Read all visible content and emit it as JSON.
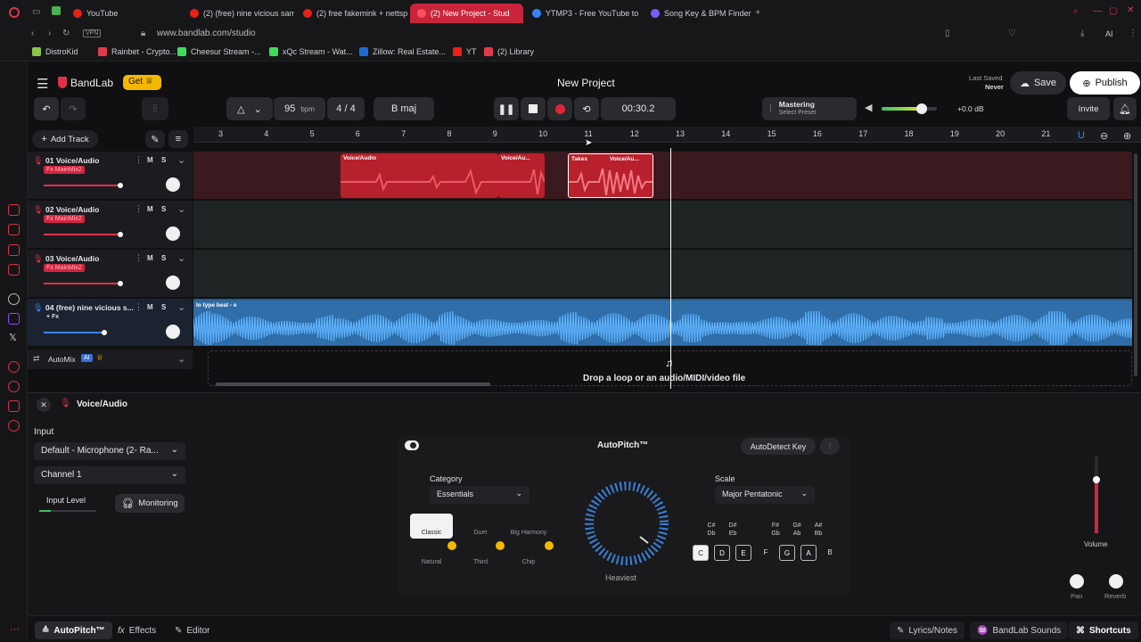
{
  "browser": {
    "tabs": [
      {
        "label": "YouTube",
        "color": "#e62117"
      },
      {
        "label": "(2) (free) nine vicious sam",
        "color": "#e62117"
      },
      {
        "label": "(2) free fakemink + nettsp",
        "color": "#e62117"
      },
      {
        "label": "(2) New Project - Stud",
        "color": "#ff4d5e",
        "active": true
      },
      {
        "label": "YTMP3 - Free YouTube to",
        "color": "#3b82f6"
      },
      {
        "label": "Song Key & BPM Finder | T",
        "color": "#7c5cff"
      }
    ],
    "url": "www.bandlab.com/studio",
    "bookmarks": [
      {
        "label": "DistroKid",
        "color": "#8bc34a"
      },
      {
        "label": "Rainbet - Crypto...",
        "color": "#e23a4b"
      },
      {
        "label": "Cheesur Stream -...",
        "color": "#3ddc5a"
      },
      {
        "label": "xQc Stream - Wat...",
        "color": "#3ddc5a"
      },
      {
        "label": "Zillow: Real Estate...",
        "color": "#1e6bd6"
      },
      {
        "label": "YT",
        "color": "#e62117"
      },
      {
        "label": "(2) Library",
        "color": "#e23a4b"
      }
    ],
    "ai_label": "AI"
  },
  "header": {
    "brand": "BandLab",
    "get_label": "Get",
    "project_title": "New Project",
    "last_saved_label": "Last Saved",
    "last_saved_value": "Never",
    "save_label": "Save",
    "publish_label": "Publish"
  },
  "transport": {
    "bpm": "95",
    "bpm_unit": "bpm",
    "time_signature": "4 / 4",
    "key": "B maj",
    "time": "00:30.2",
    "mastering_title": "Mastering",
    "mastering_sub": "Select Preset",
    "db": "+0.0 dB",
    "invite_label": "Invite",
    "volume_level": 0.7
  },
  "toolbar": {
    "add_track_label": "Add Track"
  },
  "ruler": [
    "3",
    "4",
    "5",
    "6",
    "7",
    "8",
    "9",
    "10",
    "11",
    "12",
    "13",
    "14",
    "15",
    "16",
    "17",
    "18",
    "19",
    "20",
    "21"
  ],
  "tracks": [
    {
      "name": "01  Voice/Audio",
      "fx": "Fx  MainMix2"
    },
    {
      "name": "02  Voice/Audio",
      "fx": "Fx  MainMix2"
    },
    {
      "name": "03  Voice/Audio",
      "fx": "Fx  MainMix2"
    },
    {
      "name": "04  (free) nine vicious s...",
      "fx": "+ Fx"
    }
  ],
  "regions": {
    "r1": "Voice/Audio",
    "r2": "Voice/Au...",
    "r3_takes": "Takes",
    "r3": "Voice/Au...",
    "beat": "lo type beat - e"
  },
  "automix": {
    "label": "AutoMix",
    "badge": "AI"
  },
  "drop_text": "Drop a loop or an audio/MIDI/video file",
  "panel": {
    "title": "Voice/Audio",
    "input_label": "Input",
    "input_device": "Default - Microphone (2- Ra...",
    "channel": "Channel 1",
    "input_level_label": "Input Level",
    "monitoring_label": "Monitoring",
    "autopitch_title": "AutoPitch™",
    "autodetect_label": "AutoDetect Key",
    "category_label": "Category",
    "category_value": "Essentials",
    "presets": [
      "Classic",
      "Duet",
      "Big Harmony",
      "Natural",
      "Third",
      "Chip"
    ],
    "knob_label": "Heaviest",
    "scale_label": "Scale",
    "scale_value": "Major Pentatonic",
    "sharps": [
      "C#\nDb",
      "D#\nEb",
      "F#\nGb",
      "G#\nAb",
      "A#\nBb"
    ],
    "keys": [
      "C",
      "D",
      "E",
      "F",
      "G",
      "A",
      "B"
    ],
    "volume_label": "Volume",
    "pan_label": "Pan",
    "reverb_label": "Reverb"
  },
  "footer": {
    "autopitch_label": "AutoPitch™",
    "effects_label": "Effects",
    "editor_label": "Editor",
    "lyrics_label": "Lyrics/Notes",
    "sounds_label": "BandLab Sounds",
    "shortcuts_label": "Shortcuts"
  }
}
